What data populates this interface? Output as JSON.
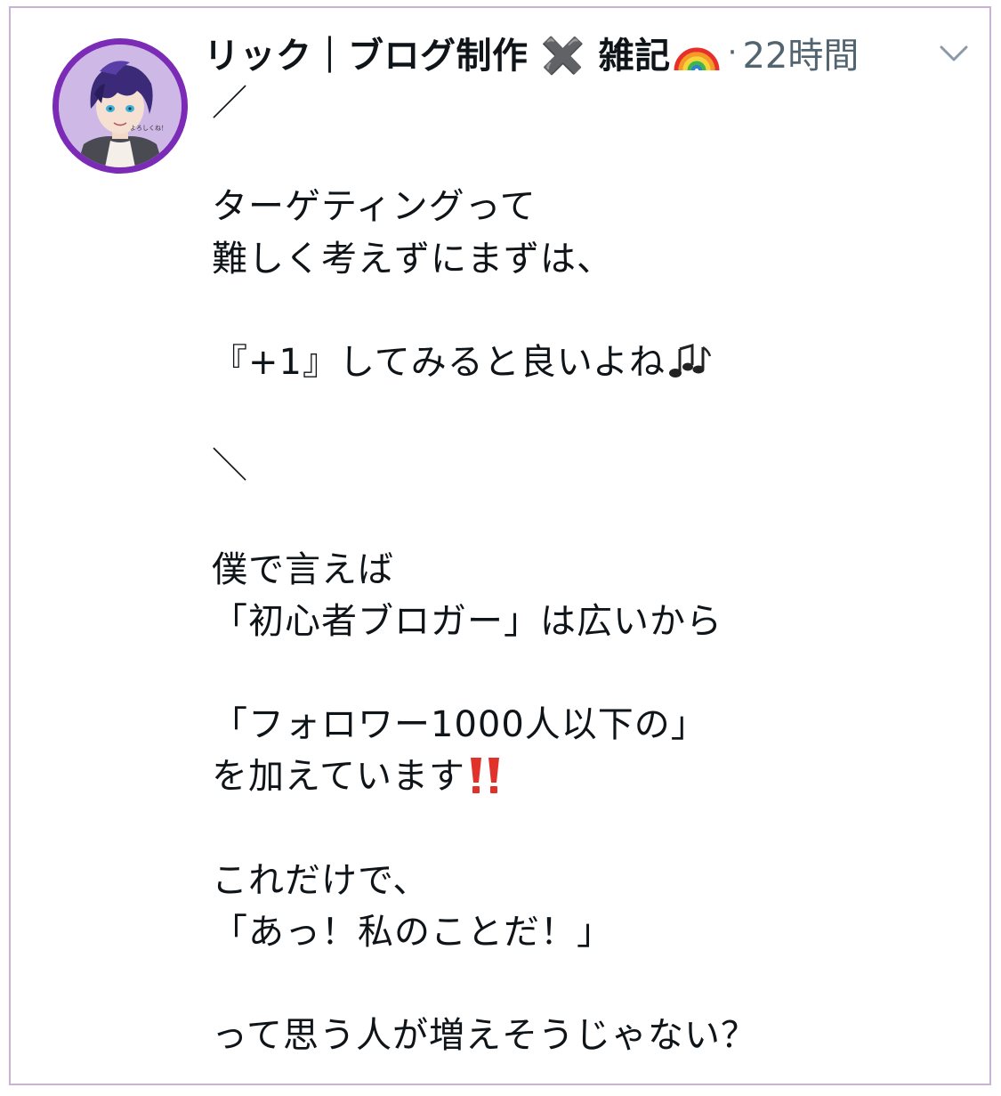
{
  "tweet": {
    "display_name": "リック｜ブログ制作 ✖️ 雑記",
    "timestamp": "22時間",
    "dot": "·",
    "avatar_caption": "よろしくね！",
    "lines": [
      "／",
      "",
      "ターゲティングって",
      "難しく考えずにまずは、",
      "",
      "『+1』してみると良いよね",
      "",
      "＼",
      "",
      "僕で言えば",
      "「初心者ブロガー」は広いから",
      "",
      "「フォロワー1000人以下の」",
      "を加えています",
      "",
      "これだけで、",
      "「あっ！私のことだ！」",
      "",
      "って思う人が増えそうじゃない？"
    ]
  },
  "icons": {
    "name_emoji": "rainbow-icon",
    "menu": "chevron-down-icon",
    "line5_emoji": "musical-notes-icon",
    "line13_emoji": "double-exclamation-icon"
  },
  "colors": {
    "avatar_ring": "#7b2bb5",
    "card_border": "#c9b3d3",
    "text": "#0f1419",
    "muted": "#536471",
    "exclamation": "#e0322a"
  }
}
